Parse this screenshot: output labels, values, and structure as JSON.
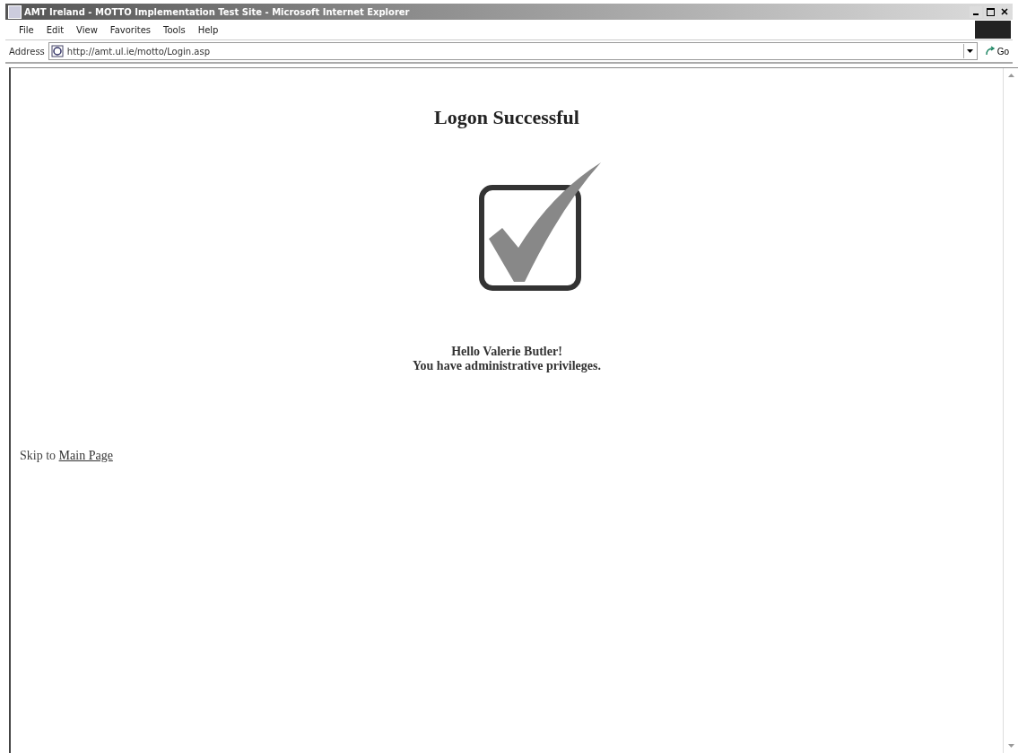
{
  "window": {
    "title": "AMT Ireland - MOTTO Implementation Test Site - Microsoft Internet Explorer"
  },
  "menu": [
    "File",
    "Edit",
    "View",
    "Favorites",
    "Tools",
    "Help"
  ],
  "address": {
    "label": "Address",
    "value": "http://amt.ul.ie/motto/Login.asp",
    "go": "Go"
  },
  "page": {
    "heading": "Logon Successful",
    "greeting": "Hello Valerie Butler!",
    "message": "You have administrative privileges.",
    "skip_text": "Skip to",
    "skip_link": "Main Page"
  }
}
